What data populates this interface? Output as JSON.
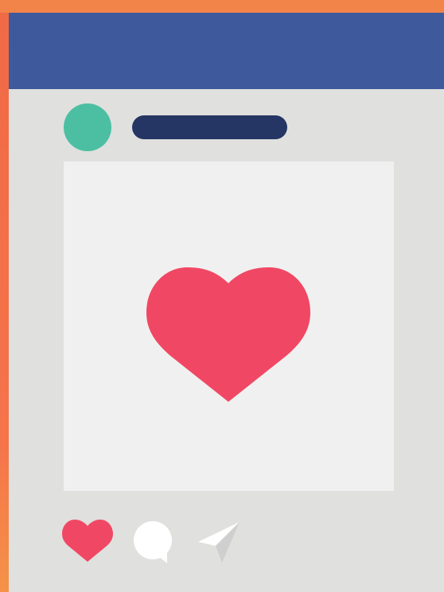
{
  "colors": {
    "frame": "#f08449",
    "header": "#3e5a9d",
    "card": "#e0e0de",
    "image": "#f0f0f0",
    "avatar": "#4cbfa2",
    "username": "#253564",
    "heart": "#f04864",
    "comment": "#ffffff",
    "share": "#d8d8d8"
  },
  "post": {
    "image_icon": "heart-icon",
    "actions": [
      "heart-icon",
      "comment-bubble-icon",
      "send-icon"
    ]
  }
}
